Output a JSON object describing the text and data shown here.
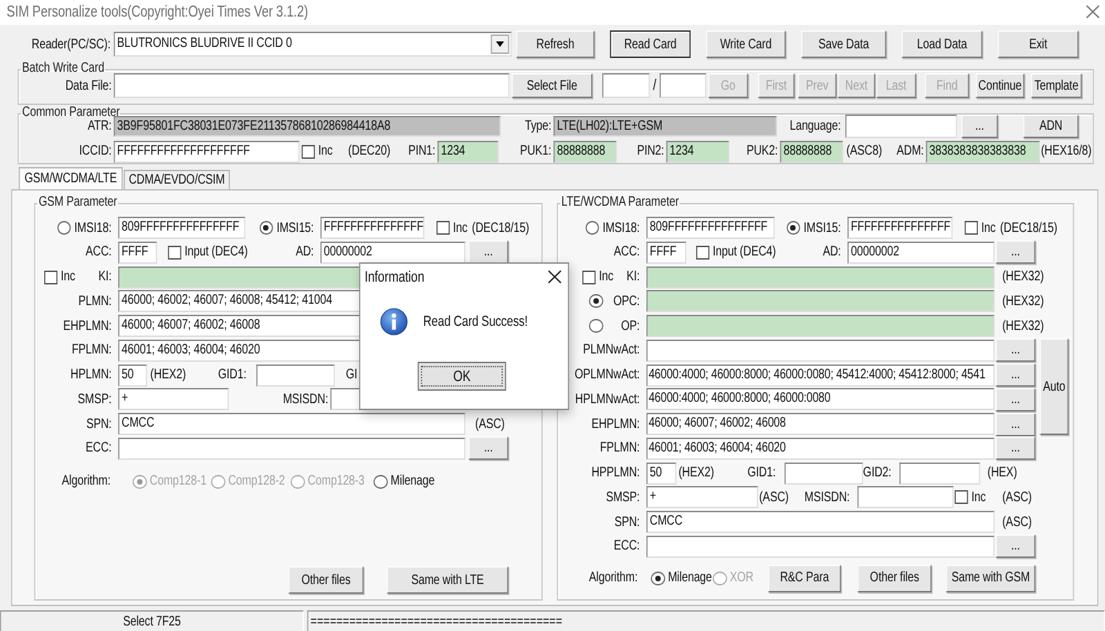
{
  "window": {
    "title": "SIM Personalize tools(Copyright:Oyei Times Ver 3.1.2)"
  },
  "reader": {
    "label": "Reader(PC/SC):",
    "value": "BLUTRONICS BLUDRIVE II CCID 0"
  },
  "toolbar": [
    {
      "label": "Refresh",
      "default": false
    },
    {
      "label": "Read Card",
      "default": true
    },
    {
      "label": "Write Card",
      "default": false
    },
    {
      "label": "Save Data",
      "default": false
    },
    {
      "label": "Load Data",
      "default": false
    },
    {
      "label": "Exit",
      "default": false
    }
  ],
  "batch": {
    "title": "Batch Write Card",
    "data_file": {
      "label": "Data File:"
    },
    "select_button": "Select File",
    "separator": "/",
    "nav_buttons": [
      {
        "label": "Go",
        "disabled": true
      },
      {
        "label": "First",
        "disabled": true
      },
      {
        "label": "Prev",
        "disabled": true
      },
      {
        "label": "Next",
        "disabled": true
      },
      {
        "label": "Last",
        "disabled": true
      },
      {
        "label": "Find",
        "disabled": true
      },
      {
        "label": "Continue",
        "disabled": false
      },
      {
        "label": "Template",
        "disabled": false
      }
    ]
  },
  "common": {
    "title": "Common Parameter",
    "atr": {
      "label": "ATR:",
      "value": "3B9F95801FC38031E073FE21135786810286984418A8"
    },
    "type": {
      "label": "Type:",
      "value": "LTE(LH02):LTE+GSM"
    },
    "language": {
      "label": "Language:",
      "button": "..."
    },
    "adn_button": "ADN",
    "iccid": {
      "label": "ICCID:",
      "value": "FFFFFFFFFFFFFFFFFFFF",
      "format": "(DEC20)"
    },
    "iccid_inc": {
      "label": "Inc",
      "checked": false
    },
    "codes": [
      {
        "label": "PIN1:",
        "value": "1234"
      },
      {
        "label": "PUK1:",
        "value": "88888888"
      },
      {
        "label": "PIN2:",
        "value": "1234"
      },
      {
        "label": "PUK2:",
        "value": "88888888"
      }
    ],
    "puk2_format": "(ASC8)",
    "adm": {
      "label": "ADM:",
      "value": "3838383838383838",
      "format": "(HEX16/8)"
    }
  },
  "tabs": [
    {
      "label": "GSM/WCDMA/LTE",
      "selected": true
    },
    {
      "label": "CDMA/EVDO/CSIM",
      "selected": false
    }
  ],
  "gsm": {
    "title": "GSM Parameter",
    "imsi18": {
      "label": "IMSI18:",
      "value": "809FFFFFFFFFFFFFFF",
      "selected": false
    },
    "imsi15": {
      "label": "IMSI15:",
      "value": "FFFFFFFFFFFFFFF",
      "selected": true
    },
    "imsi_inc": {
      "label": "Inc",
      "checked": false
    },
    "imsi_format": "(DEC18/15)",
    "acc": {
      "label": "ACC:",
      "value": "FFFF"
    },
    "acc_input": {
      "label": "Input (DEC4)",
      "checked": false
    },
    "ad": {
      "label": "AD:",
      "value": "00000002",
      "button": "..."
    },
    "ki_inc": {
      "label": "Inc",
      "checked": false
    },
    "ki": {
      "label": "KI:"
    },
    "plmn_rows": [
      {
        "label": "PLMN:",
        "value": "46000; 46002; 46007; 46008; 45412; 41004"
      },
      {
        "label": "EHPLMN:",
        "value": "46000; 46007; 46002; 46008"
      },
      {
        "label": "FPLMN:",
        "value": "46001; 46003; 46004; 46020"
      }
    ],
    "hplmn": {
      "label": "HPLMN:",
      "value": "50",
      "format": "(HEX2)"
    },
    "gid1": {
      "label": "GID1:"
    },
    "gid2": {
      "label": "GI"
    },
    "smsp": {
      "label": "SMSP:",
      "value": "+"
    },
    "msisdn": {
      "label": "MSISDN:"
    },
    "spn": {
      "label": "SPN:",
      "value": "CMCC",
      "format": "(ASC)"
    },
    "ecc": {
      "label": "ECC:",
      "button": "..."
    },
    "algorithm": {
      "label": "Algorithm:",
      "options": [
        {
          "label": "Comp128-1",
          "selected": true,
          "disabled": true
        },
        {
          "label": "Comp128-2",
          "selected": false,
          "disabled": true
        },
        {
          "label": "Comp128-3",
          "selected": false,
          "disabled": true
        },
        {
          "label": "Milenage",
          "selected": false,
          "disabled": false
        }
      ]
    },
    "buttons": [
      "Other files",
      "Same with LTE"
    ]
  },
  "lte": {
    "title": "LTE/WCDMA Parameter",
    "imsi18": {
      "label": "IMSI18:",
      "value": "809FFFFFFFFFFFFFFF",
      "selected": false
    },
    "imsi15": {
      "label": "IMSI15:",
      "value": "FFFFFFFFFFFFFFF",
      "selected": true
    },
    "imsi_inc": {
      "label": "Inc",
      "checked": false
    },
    "imsi_format": "(DEC18/15)",
    "acc": {
      "label": "ACC:",
      "value": "FFFF"
    },
    "acc_input": {
      "label": "Input (DEC4)",
      "checked": false
    },
    "ad": {
      "label": "AD:",
      "value": "00000002",
      "button": "..."
    },
    "ki_inc": {
      "label": "Inc",
      "checked": false
    },
    "ki": {
      "label": "KI:",
      "format": "(HEX32)"
    },
    "opc": {
      "label": "OPC:",
      "selected": true,
      "format": "(HEX32)"
    },
    "op": {
      "label": "OP:",
      "selected": false,
      "format": "(HEX32)"
    },
    "plmn_rows": [
      {
        "label": "PLMNwAct:",
        "button": "..."
      },
      {
        "label": "OPLMNwAct:",
        "value": "46000:4000; 46000:8000; 46000:0080; 45412:4000; 45412:8000; 4541",
        "button": "..."
      },
      {
        "label": "HPLMNwAct:",
        "value": "46000:4000; 46000:8000; 46000:0080",
        "button": "..."
      },
      {
        "label": "EHPLMN:",
        "value": "46000; 46007; 46002; 46008",
        "button": "..."
      },
      {
        "label": "FPLMN:",
        "value": "46001; 46003; 46004; 46020",
        "button": "..."
      }
    ],
    "auto_button": "Auto",
    "hpplmn": {
      "label": "HPPLMN:",
      "value": "50",
      "format": "(HEX2)"
    },
    "gid1": {
      "label": "GID1:"
    },
    "gid2": {
      "label": "GID2:",
      "format": "(HEX)"
    },
    "smsp": {
      "label": "SMSP:",
      "value": "+",
      "format": "(ASC)"
    },
    "msisdn": {
      "label": "MSISDN:",
      "format": "(ASC)"
    },
    "msisdn_inc": {
      "label": "Inc",
      "checked": false
    },
    "spn": {
      "label": "SPN:",
      "value": "CMCC",
      "format": "(ASC)"
    },
    "ecc": {
      "label": "ECC:",
      "button": "..."
    },
    "algorithm": {
      "label": "Algorithm:",
      "options": [
        {
          "label": "Milenage",
          "selected": true,
          "disabled": false
        },
        {
          "label": "XOR",
          "selected": false,
          "disabled": true
        }
      ]
    },
    "buttons": [
      "R&C Para",
      "Other files",
      "Same with GSM"
    ]
  },
  "dialog": {
    "title": "Information",
    "message": "Read Card Success!",
    "button": "OK"
  },
  "status_bar": {
    "message": "Select 7F25",
    "progress": "======================================="
  }
}
